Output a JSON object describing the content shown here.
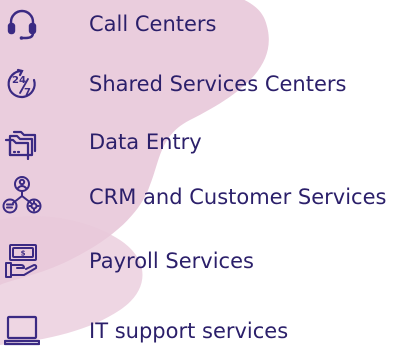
{
  "colors": {
    "text": "#2b1f6a",
    "icon": "#3b2a83",
    "blob": "#e8c8d9"
  },
  "items": [
    {
      "label": "Call Centers",
      "icon": "headset-icon"
    },
    {
      "label": "Shared Services Centers",
      "icon": "24-7-icon"
    },
    {
      "label": "Data Entry",
      "icon": "folders-icon"
    },
    {
      "label": "CRM and Customer Services",
      "icon": "customer-network-icon"
    },
    {
      "label": "Payroll Services",
      "icon": "payroll-cash-hand-icon"
    },
    {
      "label": "IT support services",
      "icon": "laptop-icon"
    }
  ],
  "icon_text": {
    "twenty_four": "24",
    "seven": "7",
    "dollar": "$"
  }
}
